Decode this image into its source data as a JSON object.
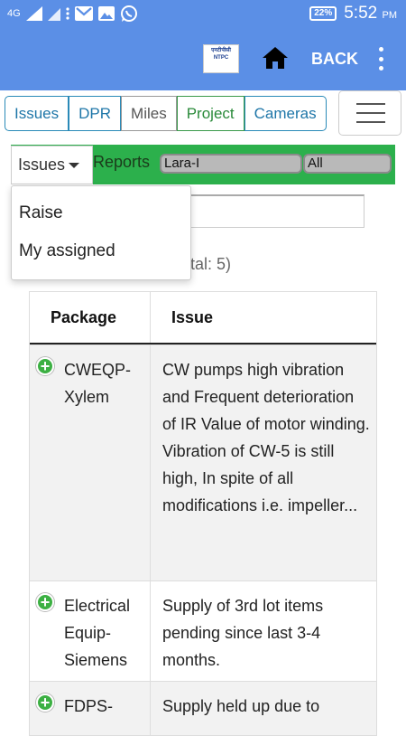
{
  "status_bar": {
    "network": "4G",
    "battery": "22%",
    "time": "5:52",
    "ampm": "PM"
  },
  "app_bar": {
    "logo_text": "एनटीपीसी NTPC",
    "back_label": "BACK"
  },
  "tabs": [
    {
      "label": "Issues"
    },
    {
      "label": "DPR"
    },
    {
      "label": "Miles"
    },
    {
      "label": "Project"
    },
    {
      "label": "Cameras"
    }
  ],
  "filter_bar": {
    "dropdown_label": "Issues",
    "reports_label": "Reports",
    "project_value": "Lara-I",
    "filter_value": "All"
  },
  "dropdown_menu": {
    "items": [
      {
        "label": "Raise"
      },
      {
        "label": "My assigned"
      }
    ]
  },
  "total_text": "tal: 5)",
  "table": {
    "headers": {
      "package": "Package",
      "issue": "Issue"
    },
    "rows": [
      {
        "package": "CWEQP-Xylem",
        "issue": "CW pumps high vibration and Frequent deterioration of IR Value of motor winding. Vibration of CW-5 is still high, In spite of all modifications i.e. impeller..."
      },
      {
        "package": "Electrical Equip-Siemens",
        "issue": "Supply of 3rd lot items pending since last 3-4 months."
      },
      {
        "package": "FDPS-",
        "issue": "Supply held up due to"
      }
    ]
  },
  "colors": {
    "app_bar": "#5b8fe6",
    "filter_bar": "#2cb04c",
    "tab_blue": "#1e76a8",
    "add_icon": "#3cb043"
  }
}
